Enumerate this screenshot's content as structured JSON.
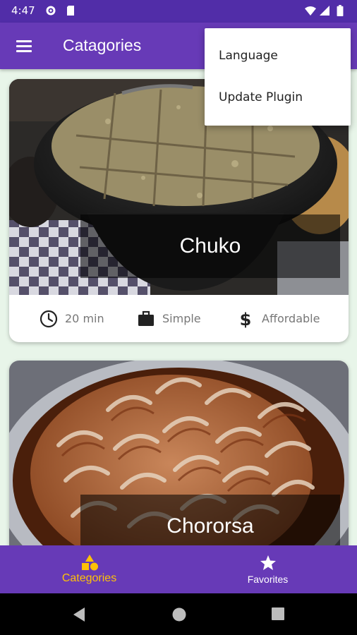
{
  "status_bar": {
    "time": "4:47"
  },
  "app_bar": {
    "title": "Catagories"
  },
  "popup_menu": {
    "items": [
      "Language",
      "Update Plugin"
    ]
  },
  "meals": [
    {
      "title": "Chuko",
      "duration": "20 min",
      "complexity": "Simple",
      "affordability": "Affordable"
    },
    {
      "title": "Chororsa"
    }
  ],
  "bottom_nav": {
    "tabs": [
      {
        "label": "Categories",
        "icon": "category-icon",
        "active": true
      },
      {
        "label": "Favorites",
        "icon": "star-icon",
        "active": false
      }
    ]
  },
  "colors": {
    "primary": "#673ab7",
    "primary_dark": "#512da8",
    "accent": "#ffc107",
    "background": "#e8f5e9"
  }
}
